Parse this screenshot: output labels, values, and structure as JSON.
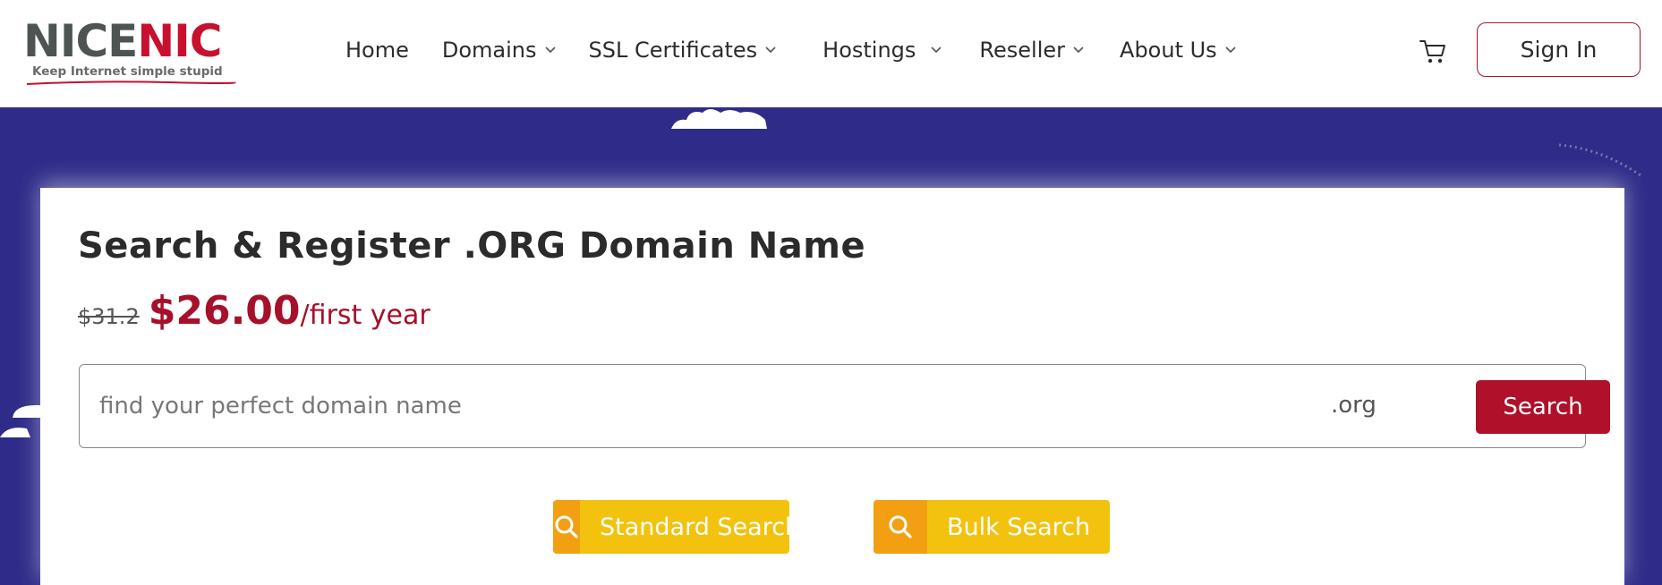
{
  "brand": {
    "logo_part1": "NICE",
    "logo_part2": "NIC",
    "tagline": "Keep Internet simple stupid",
    "colors": {
      "gray": "#4d5451",
      "red": "#c8102e"
    }
  },
  "nav": {
    "items": [
      {
        "label": "Home",
        "has_dropdown": false
      },
      {
        "label": "Domains",
        "has_dropdown": true
      },
      {
        "label": "SSL Certificates",
        "has_dropdown": true
      },
      {
        "label": "Hostings",
        "has_dropdown": true
      },
      {
        "label": "Reseller",
        "has_dropdown": true
      },
      {
        "label": "About Us",
        "has_dropdown": true
      }
    ],
    "cart_icon": "cart-icon",
    "signin_label": "Sign In"
  },
  "hero": {
    "background_color": "#2e2c88",
    "title": "Search & Register .ORG Domain Name",
    "old_price": "$31.2",
    "new_price": "$26.00",
    "price_suffix": "/first year",
    "accent_color": "#a7102a"
  },
  "search": {
    "placeholder": "find your perfect domain name",
    "value": "",
    "tld": ".org",
    "button_label": "Search"
  },
  "search_modes": {
    "standard_label": "Standard Search",
    "bulk_label": "Bulk Search",
    "icon": "search-icon",
    "button_color": "#f2c20f",
    "icon_bg_color": "#f2a012"
  }
}
